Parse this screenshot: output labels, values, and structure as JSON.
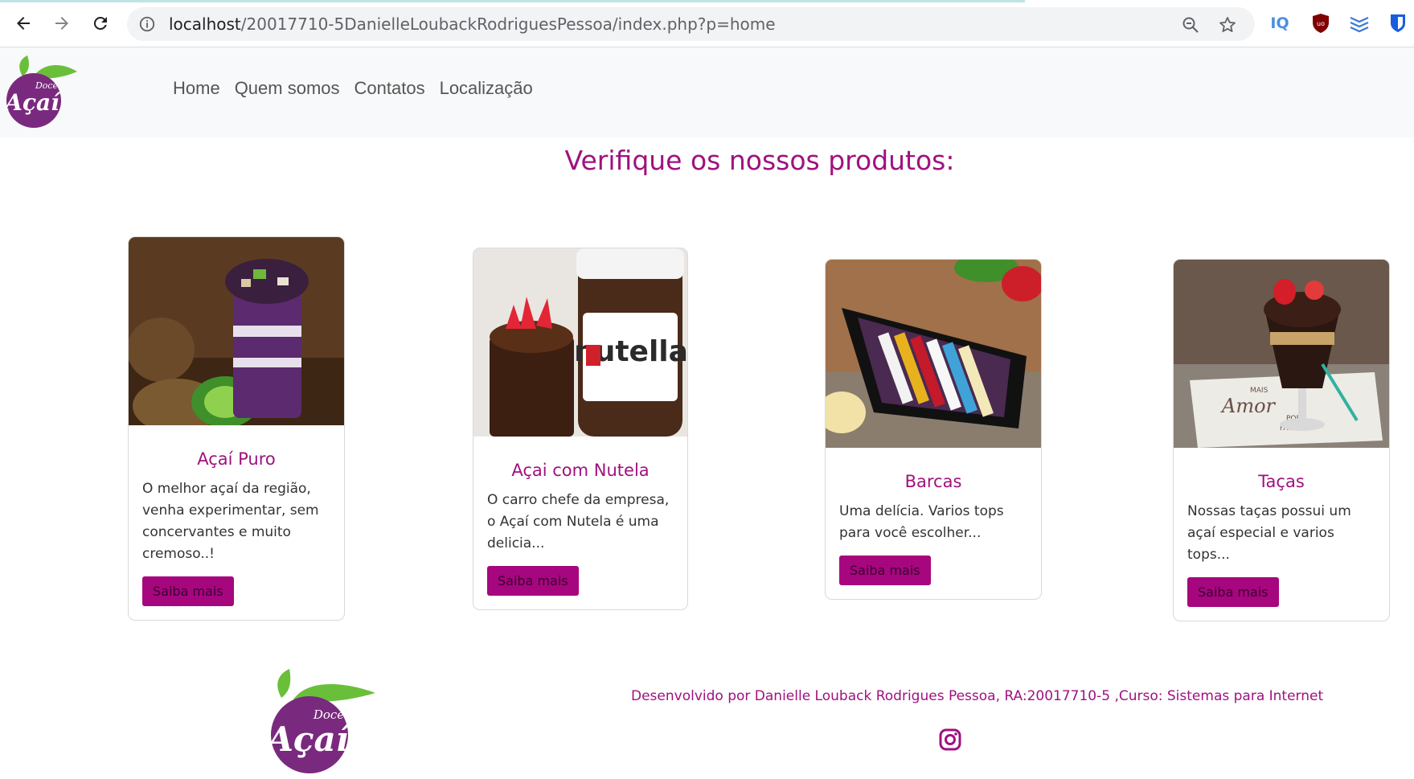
{
  "browser": {
    "url_host": "localhost",
    "url_path": "/20017710-5DanielleLoubackRodriguesPessoa/index.php?p=home",
    "extensions": [
      "IQ",
      "uBlock",
      "Z",
      "Bitwarden"
    ]
  },
  "nav": {
    "items": [
      "Home",
      "Quem somos",
      "Contatos",
      "Localização"
    ]
  },
  "logo": {
    "line1": "Doce",
    "line2": "Açaí"
  },
  "heading": "Verifique os nossos produtos:",
  "products": [
    {
      "title": "Açaí Puro",
      "description": "O melhor açaí da região, venha experimentar, sem concervantes e muito cremoso..!",
      "button": "Saiba mais"
    },
    {
      "title": "Açai com Nutela",
      "description": "O carro chefe da empresa, o Açaí com Nutela é uma delicia...",
      "button": "Saiba mais"
    },
    {
      "title": "Barcas",
      "description": "Uma delícia. Varios tops para você escolher...",
      "button": "Saiba mais"
    },
    {
      "title": "Taças",
      "description": "Nossas taças possui um açaí especial e varios tops...",
      "button": "Saiba mais"
    }
  ],
  "image_text": {
    "nutella_label": "nutella",
    "cup_text": [
      "MAIS",
      "Amor",
      "POR",
      "FAVOR"
    ]
  },
  "footer": {
    "credit": "Desenvolvido por Danielle Louback Rodrigues Pessoa, RA:20017710-5 ,Curso: Sistemas para Internet"
  },
  "colors": {
    "brand": "#a0117f",
    "button": "#a6067e",
    "leaf": "#6abf3a"
  }
}
